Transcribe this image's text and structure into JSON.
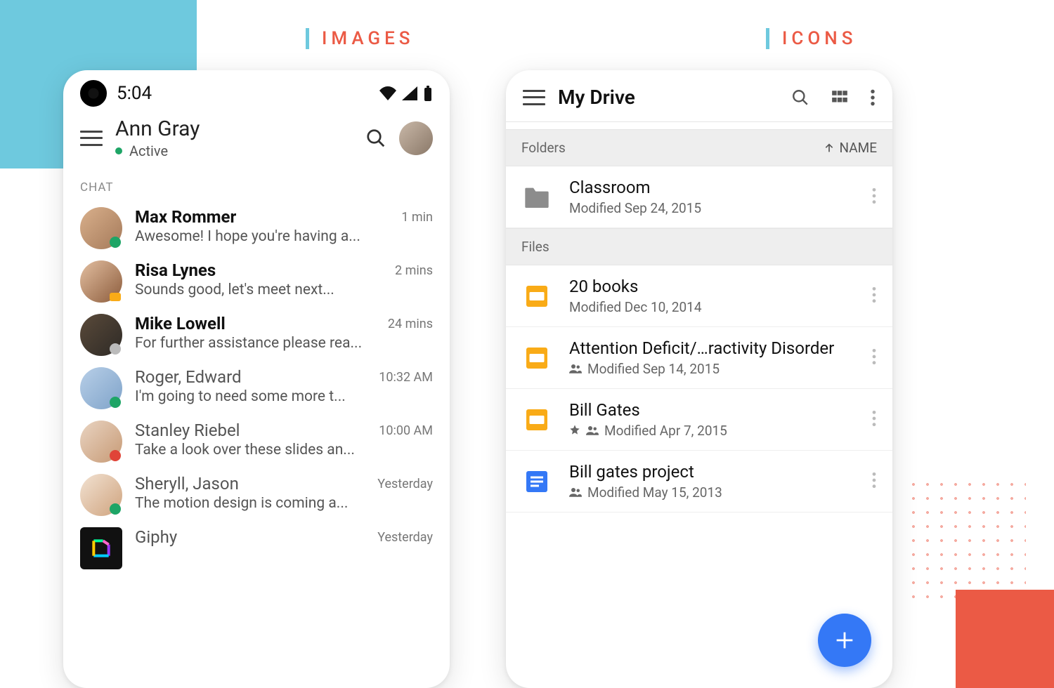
{
  "labels": {
    "images": "IMAGES",
    "icons": "ICONS"
  },
  "chatApp": {
    "statusTime": "5:04",
    "headerName": "Ann Gray",
    "headerStatus": "Active",
    "sectionLabel": "CHAT",
    "rows": [
      {
        "name": "Max Rommer",
        "preview": "Awesome! I hope you're having a...",
        "time": "1 min",
        "bold": true,
        "badge": "online",
        "avatar": "av-c1"
      },
      {
        "name": "Risa Lynes",
        "preview": "Sounds good, let's meet next...",
        "time": "2 mins",
        "bold": true,
        "badge": "video",
        "avatar": "av-c2"
      },
      {
        "name": "Mike Lowell",
        "preview": "For further assistance please rea...",
        "time": "24 mins",
        "bold": true,
        "badge": "away",
        "avatar": "av-c3"
      },
      {
        "name": "Roger, Edward",
        "preview": "I'm going to need some more t...",
        "time": "10:32 AM",
        "bold": false,
        "badge": "online",
        "avatar": "av-c4"
      },
      {
        "name": "Stanley Riebel",
        "preview": "Take a look over these slides an...",
        "time": "10:00 AM",
        "bold": false,
        "badge": "dnd",
        "avatar": "av-c5"
      },
      {
        "name": "Sheryll, Jason",
        "preview": "The motion design is coming  a...",
        "time": "Yesterday",
        "bold": false,
        "badge": "online",
        "avatar": "av-c6"
      },
      {
        "name": "Giphy",
        "preview": "",
        "time": "Yesterday",
        "bold": false,
        "badge": "none",
        "avatar": "giphy"
      }
    ]
  },
  "driveApp": {
    "title": "My Drive",
    "foldersLabel": "Folders",
    "filesLabel": "Files",
    "sortLabel": "NAME",
    "folders": [
      {
        "name": "Classroom",
        "meta": "Modified Sep 24, 2015"
      }
    ],
    "files": [
      {
        "name": "20 books",
        "meta": "Modified Dec 10, 2014",
        "type": "slides",
        "shared": false,
        "starred": false
      },
      {
        "name": "Attention Deficit/…ractivity Disorder",
        "meta": "Modified Sep 14, 2015",
        "type": "slides",
        "shared": true,
        "starred": false
      },
      {
        "name": "Bill Gates",
        "meta": "Modified Apr 7, 2015",
        "type": "slides",
        "shared": true,
        "starred": true
      },
      {
        "name": "Bill gates project",
        "meta": "Modified May 15, 2013",
        "type": "doc",
        "shared": true,
        "starred": false
      }
    ]
  }
}
